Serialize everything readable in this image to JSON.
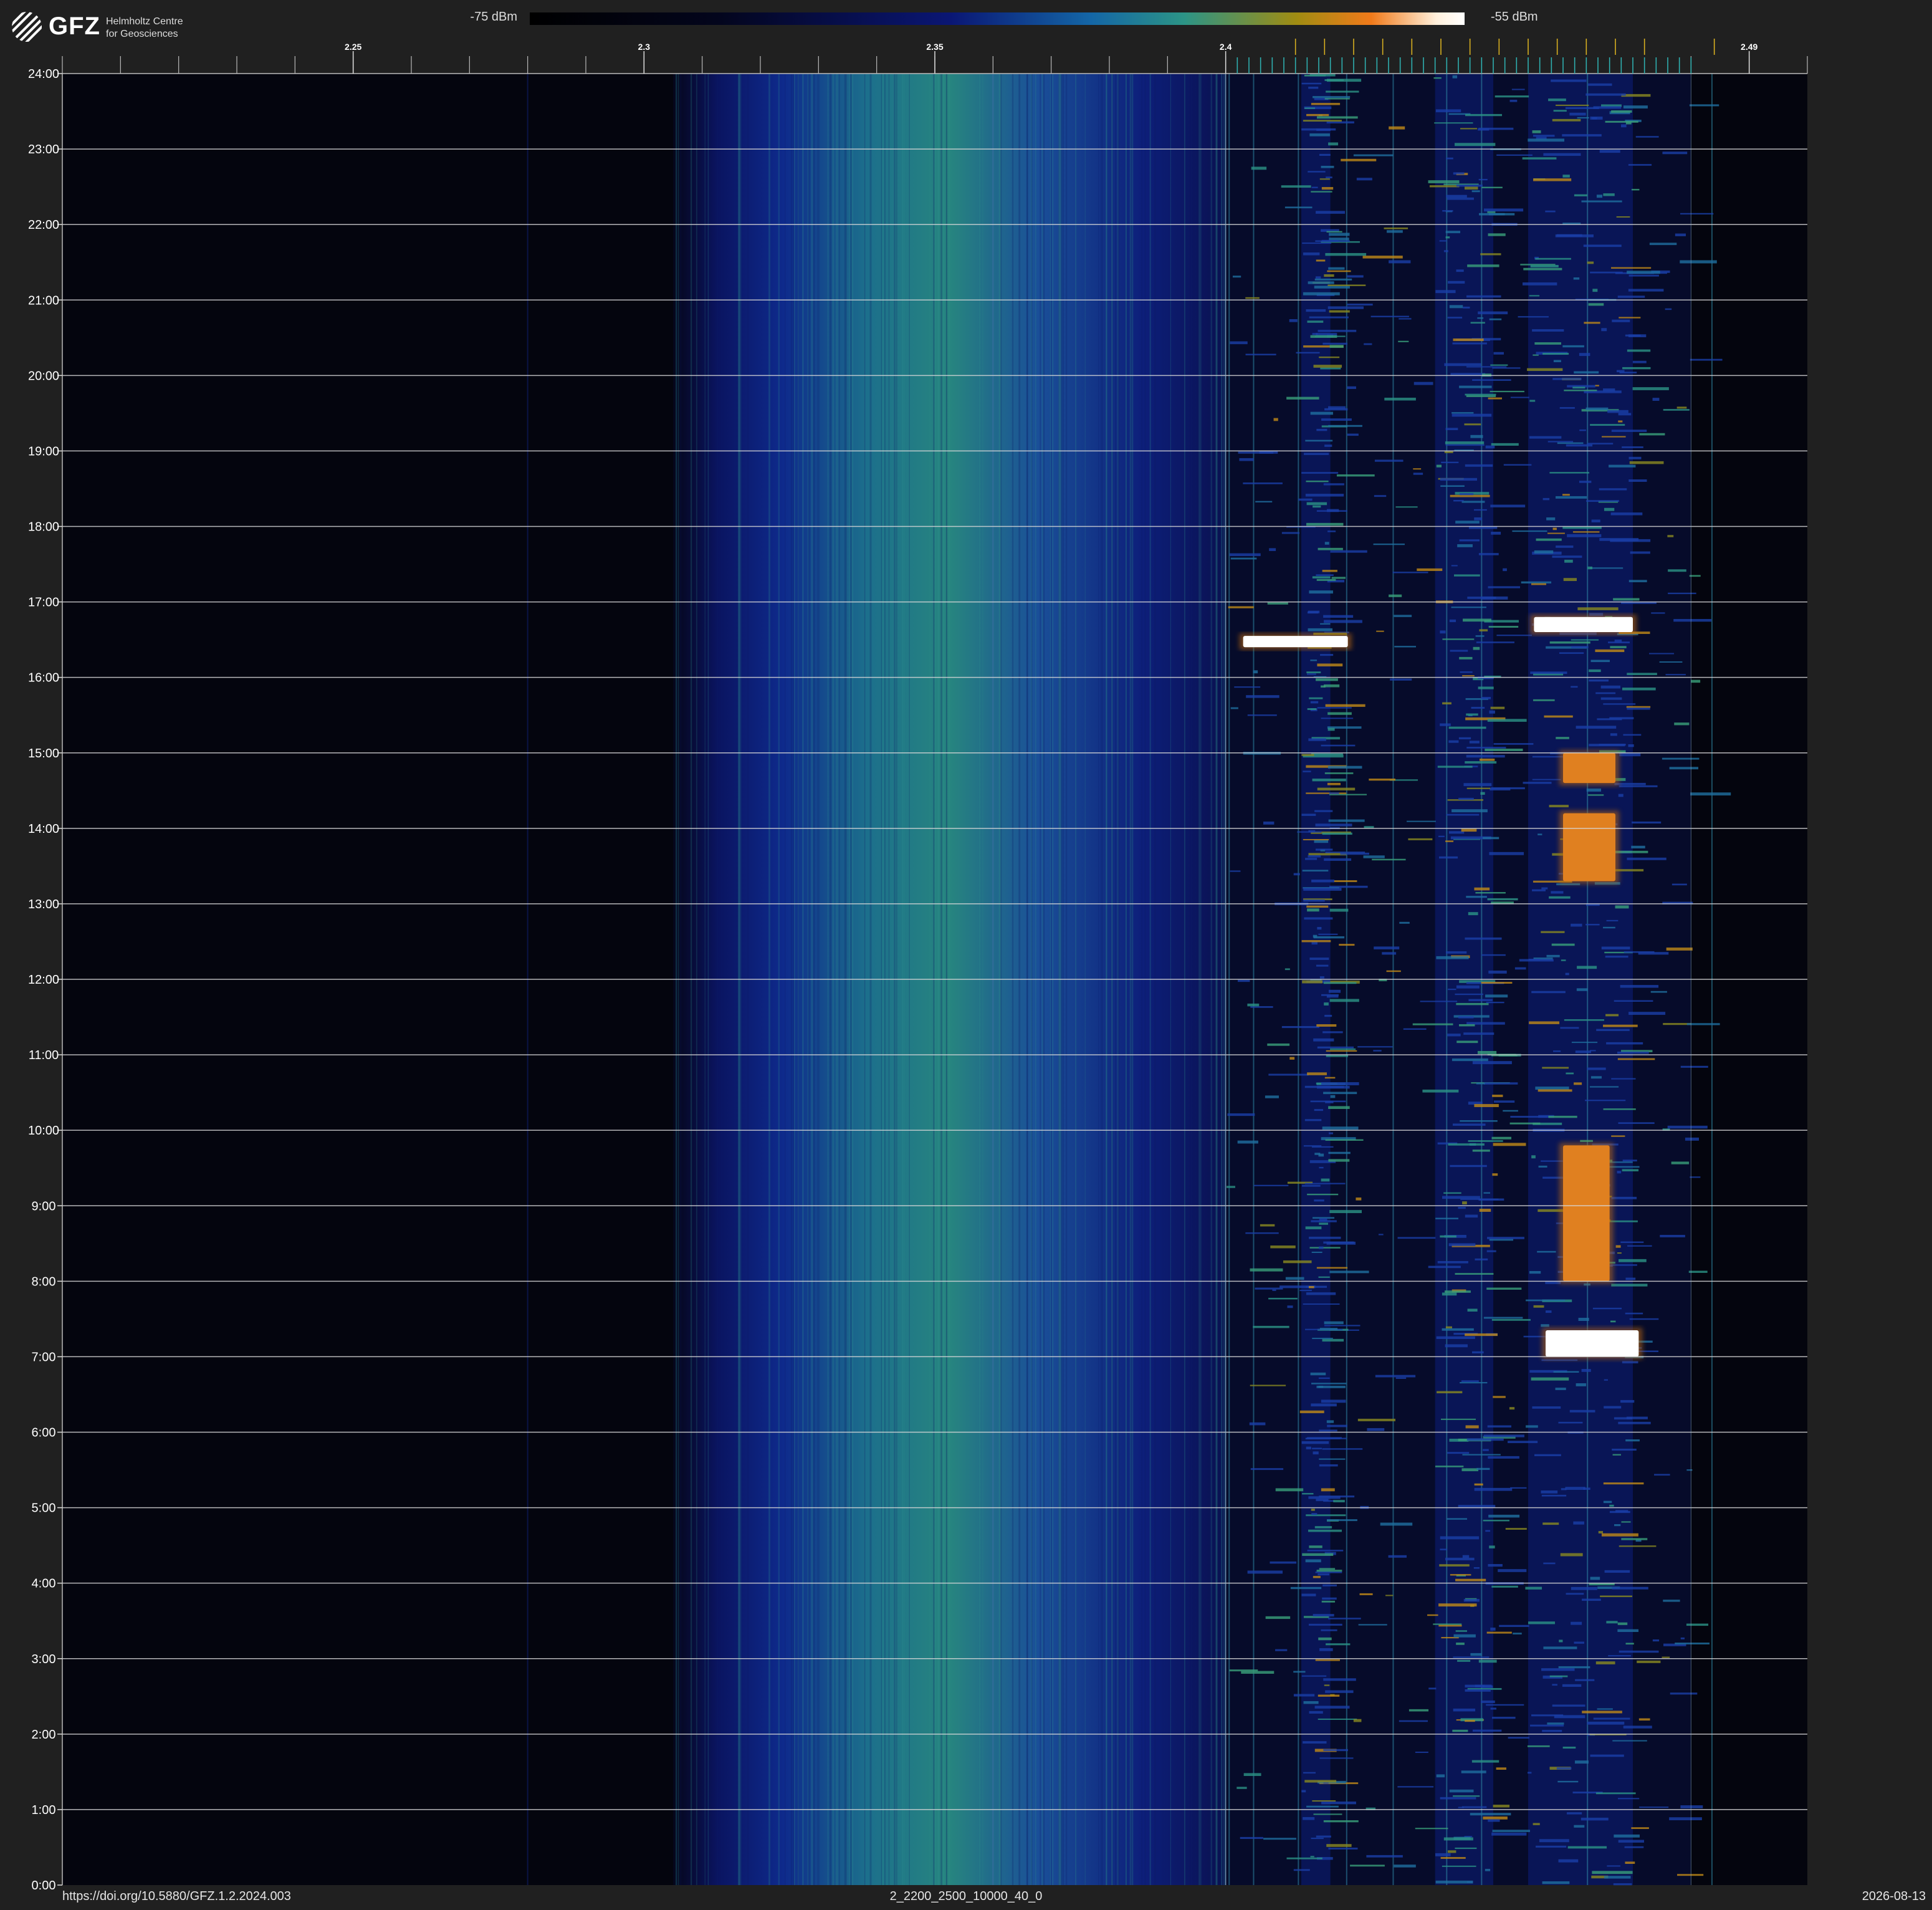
{
  "logo": {
    "mark_text": "GFZ",
    "org_line1": "Helmholtz Centre",
    "org_line2": "for Geosciences"
  },
  "colorbar": {
    "min_label": "-75 dBm",
    "max_label": "-55 dBm",
    "min_dbm": -75,
    "max_dbm": -55,
    "colormap_stops": [
      "#000000",
      "#03051c",
      "#0a1674",
      "#1466a6",
      "#2c9486",
      "#a08c12",
      "#f07a1a",
      "#fff0dc",
      "#ffffff"
    ]
  },
  "footer": {
    "doi": "https://doi.org/10.5880/GFZ.1.2.2024.003",
    "file_id": "2_2200_2500_10000_40_0",
    "date": "2026-08-13"
  },
  "chart_data": {
    "type": "heatmap",
    "title": "",
    "xlabel": "",
    "ylabel": "",
    "xlim": [
      2.2,
      2.5
    ],
    "ylim": [
      0,
      24
    ],
    "x_ticks": [
      {
        "value": 2.25,
        "label": "2.25"
      },
      {
        "value": 2.3,
        "label": "2.3"
      },
      {
        "value": 2.35,
        "label": "2.35"
      },
      {
        "value": 2.4,
        "label": "2.4"
      },
      {
        "value": 2.49,
        "label": "2.49"
      }
    ],
    "x_minor_tick_step": 0.01,
    "channel_markers": [
      2.402,
      2.404,
      2.406,
      2.408,
      2.41,
      2.412,
      2.414,
      2.416,
      2.418,
      2.42,
      2.422,
      2.424,
      2.426,
      2.428,
      2.43,
      2.432,
      2.434,
      2.436,
      2.438,
      2.44,
      2.442,
      2.444,
      2.446,
      2.448,
      2.45,
      2.452,
      2.454,
      2.456,
      2.458,
      2.46,
      2.462,
      2.464,
      2.466,
      2.468,
      2.47,
      2.472,
      2.474,
      2.476,
      2.478,
      2.48
    ],
    "channel_markers_yellow": [
      2.412,
      2.417,
      2.422,
      2.427,
      2.432,
      2.437,
      2.442,
      2.447,
      2.452,
      2.457,
      2.462,
      2.467,
      2.472,
      2.484
    ],
    "y_ticks": [
      "0:00",
      "1:00",
      "2:00",
      "3:00",
      "4:00",
      "5:00",
      "6:00",
      "7:00",
      "8:00",
      "9:00",
      "10:00",
      "11:00",
      "12:00",
      "13:00",
      "14:00",
      "15:00",
      "16:00",
      "17:00",
      "18:00",
      "19:00",
      "20:00",
      "21:00",
      "22:00",
      "23:00",
      "24:00"
    ],
    "grid": true,
    "background_band": {
      "x_start": 2.305,
      "x_center": 2.34,
      "x_end": 2.4,
      "level_dbm": -66
    },
    "strong_signals": [
      {
        "x_start": 2.403,
        "x_end": 2.421,
        "y_start": 16.4,
        "y_end": 16.55,
        "level_dbm": -55
      },
      {
        "x_start": 2.453,
        "x_end": 2.47,
        "y_start": 16.6,
        "y_end": 16.8,
        "level_dbm": -55
      },
      {
        "x_start": 2.455,
        "x_end": 2.471,
        "y_start": 7.0,
        "y_end": 7.35,
        "level_dbm": -55
      },
      {
        "x_start": 2.458,
        "x_end": 2.467,
        "y_start": 13.3,
        "y_end": 14.2,
        "level_dbm": -58
      },
      {
        "x_start": 2.458,
        "x_end": 2.467,
        "y_start": 14.6,
        "y_end": 15.0,
        "level_dbm": -58
      },
      {
        "x_start": 2.458,
        "x_end": 2.466,
        "y_start": 8.0,
        "y_end": 9.8,
        "level_dbm": -59
      }
    ]
  }
}
